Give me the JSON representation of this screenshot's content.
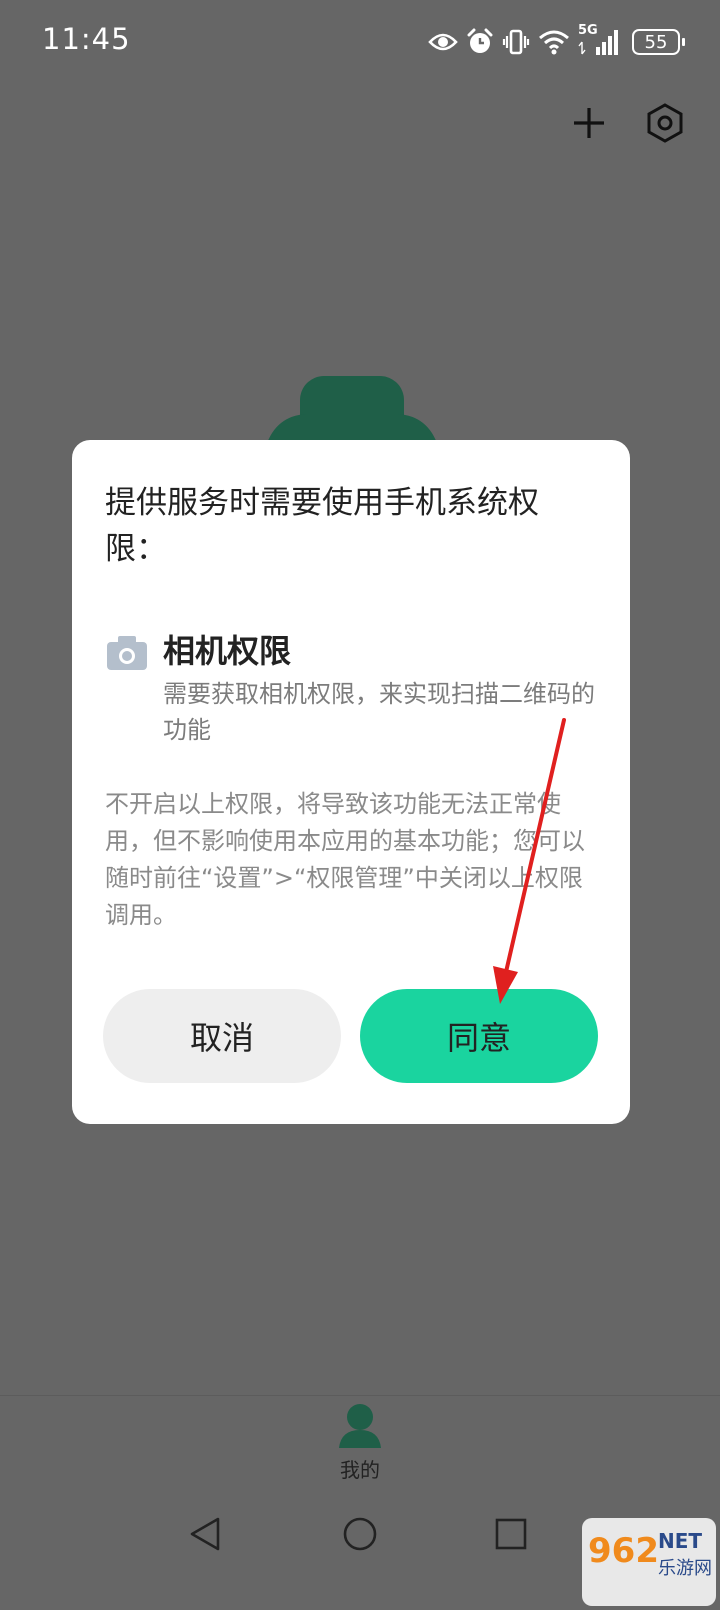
{
  "status_bar": {
    "time": "11:45",
    "network_label": "5G",
    "battery": "55",
    "icons": [
      "eye-icon",
      "alarm-icon",
      "vibrate-icon",
      "wifi-icon",
      "signal-icon",
      "battery-icon"
    ]
  },
  "top_actions": {
    "icons": [
      "plus-icon",
      "settings-icon"
    ]
  },
  "dialog": {
    "title": "提供服务时需要使用手机系统权限：",
    "permission": {
      "icon": "camera-icon",
      "name": "相机权限",
      "description": "需要获取相机权限，来实现扫描二维码的功能"
    },
    "notice": "不开启以上权限，将导致该功能无法正常使用，但不影响使用本应用的基本功能；您可以随时前往“设置”>“权限管理”中关闭以上权限调用。",
    "cancel_label": "取消",
    "agree_label": "同意"
  },
  "bottom_nav": {
    "items": [
      {
        "label": "我的",
        "icon": "profile-icon"
      }
    ]
  },
  "system_nav": {
    "icons": [
      "back-icon",
      "home-icon",
      "recents-icon"
    ]
  },
  "watermark": {
    "brand": "962",
    "suffix": "NET",
    "site": "乐游网"
  },
  "colors": {
    "accent": "#1ad49f",
    "overlay": "#666666",
    "dialog_bg": "#ffffff",
    "cancel_bg": "#eeeeee",
    "annotation": "#e0201f",
    "brand_dark": "#1f5f48"
  }
}
